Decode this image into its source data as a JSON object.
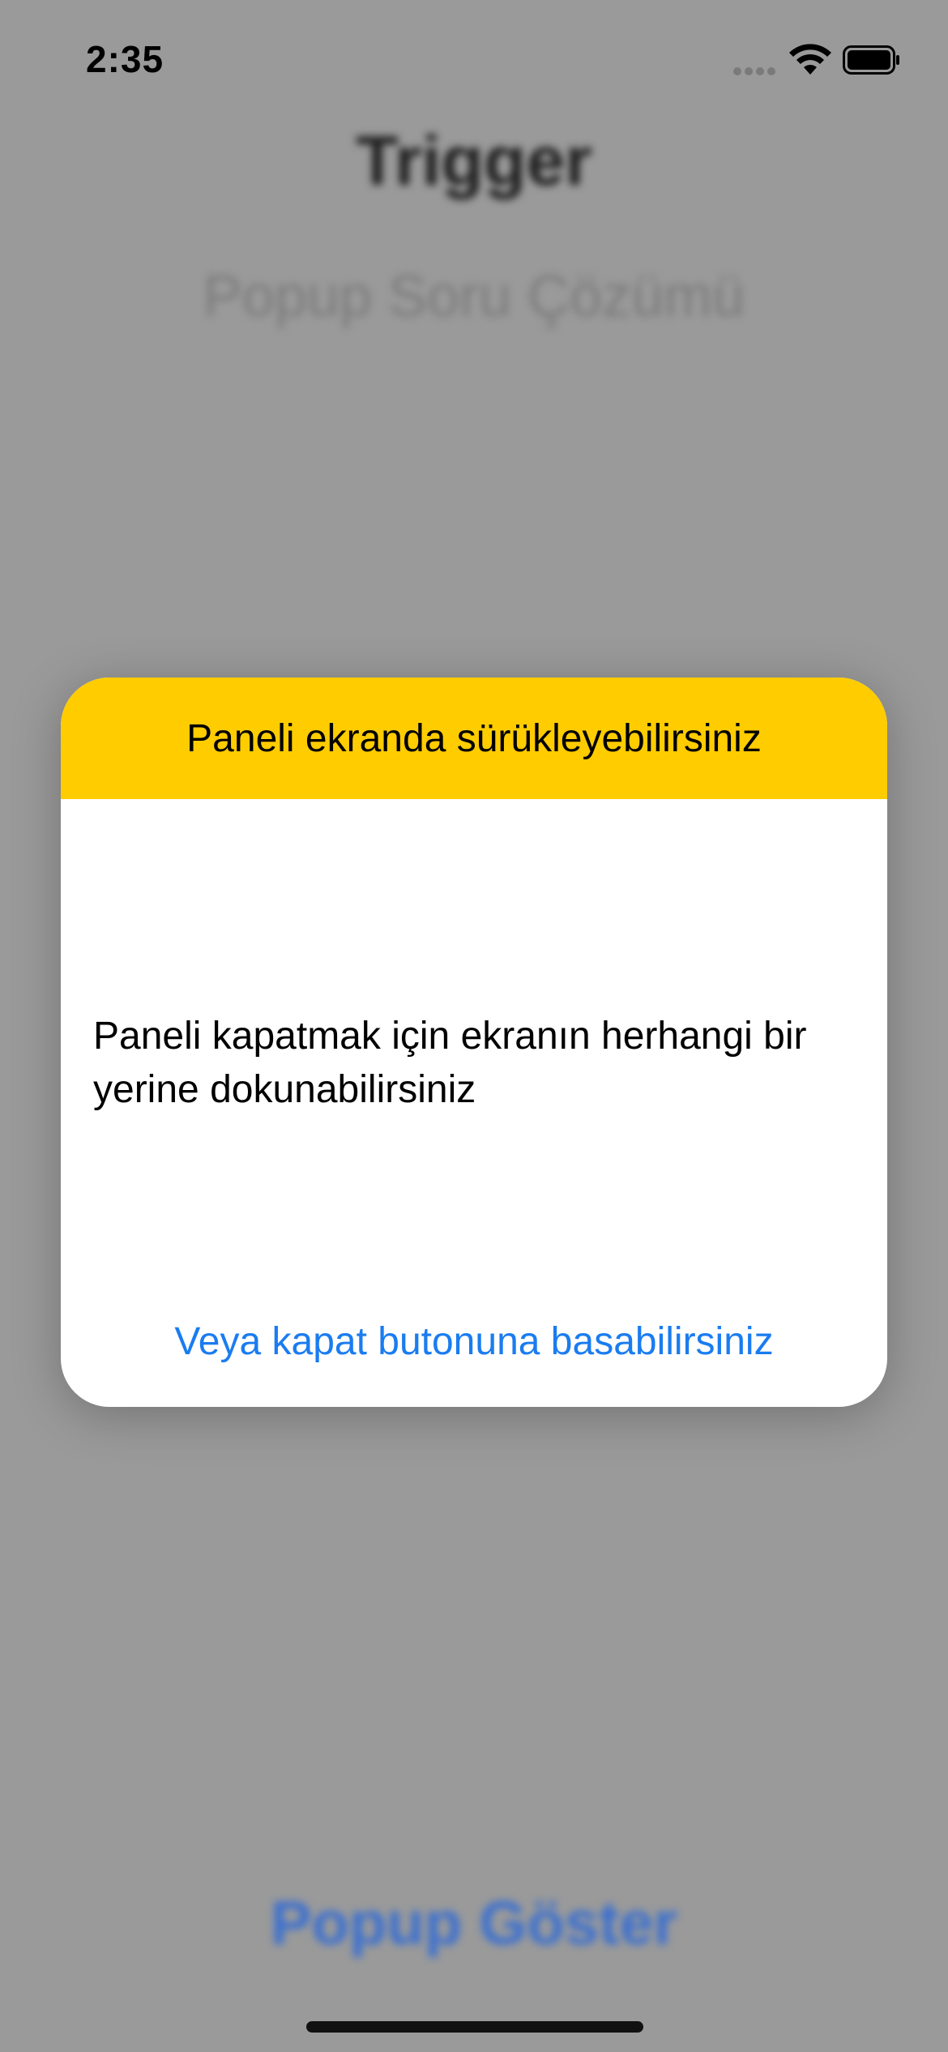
{
  "status_bar": {
    "time": "2:35",
    "icons": [
      "signal-dots-icon",
      "wifi-icon",
      "battery-icon"
    ]
  },
  "background": {
    "title": "Trigger",
    "subtitle": "Popup Soru Çözümü",
    "show_popup_button": "Popup Göster"
  },
  "popup": {
    "header": "Paneli ekranda sürükleyebilirsiniz",
    "body": "Paneli kapatmak için ekranın herhangi bir yerine dokunabilirsiniz",
    "close_link": "Veya kapat butonuna basabilirsiniz"
  },
  "colors": {
    "overlay": "#9a9a9a",
    "header_accent": "#ffcc00",
    "link": "#1a7cf0",
    "bg_button": "#3a6fd0"
  }
}
